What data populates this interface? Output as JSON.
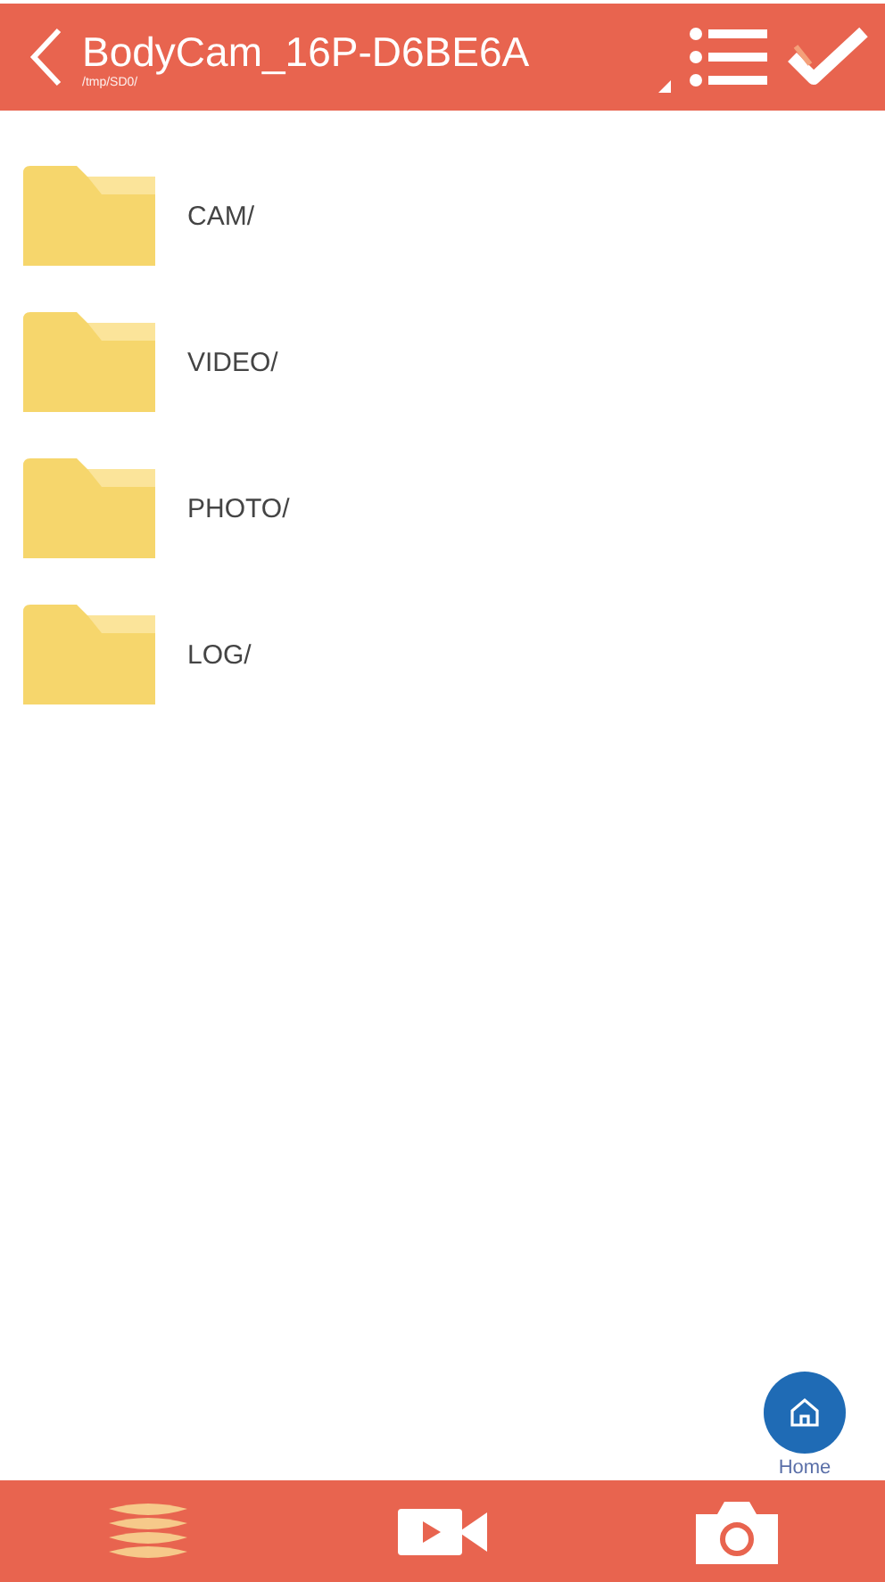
{
  "header": {
    "title": "BodyCam_16P-D6BE6A",
    "path": "/tmp/SD0/"
  },
  "folders": [
    {
      "name": "CAM/"
    },
    {
      "name": "VIDEO/"
    },
    {
      "name": "PHOTO/"
    },
    {
      "name": "LOG/"
    }
  ],
  "home_button": {
    "label": "Home"
  },
  "tabs": [
    {
      "kind": "files",
      "selected": true
    },
    {
      "kind": "video",
      "selected": false
    },
    {
      "kind": "photo",
      "selected": false
    }
  ]
}
